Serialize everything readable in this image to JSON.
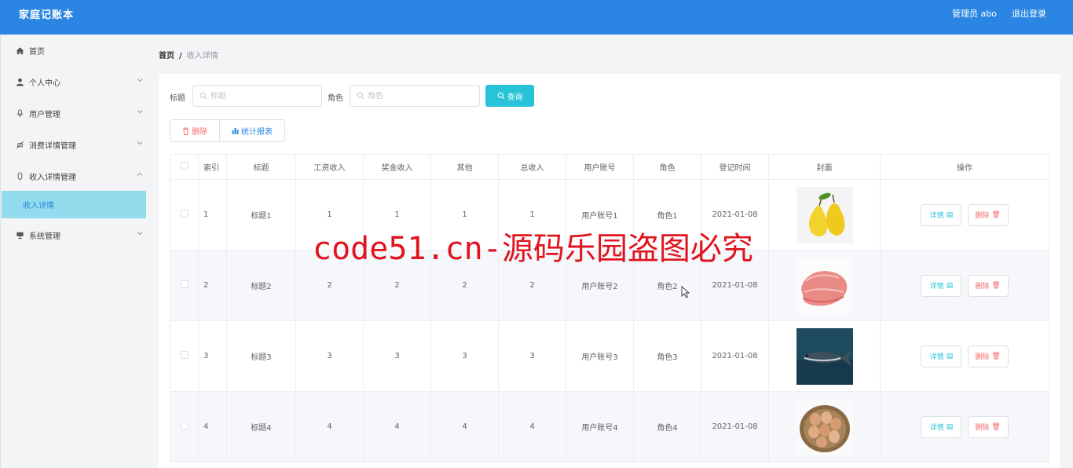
{
  "app": {
    "title": "家庭记账本",
    "user": "管理员 abo",
    "logout": "退出登录"
  },
  "sidebar": {
    "items": [
      {
        "label": "首页",
        "icon": "home-icon"
      },
      {
        "label": "个人中心",
        "icon": "user-icon"
      },
      {
        "label": "用户管理",
        "icon": "mic-icon"
      },
      {
        "label": "消费详情管理",
        "icon": "bell-off-icon"
      },
      {
        "label": "收入详情管理",
        "icon": "mic-icon"
      },
      {
        "label": "系统管理",
        "icon": "monitor-icon"
      }
    ],
    "active_sub": "收入详情"
  },
  "breadcrumb": {
    "home": "首页",
    "sep": "/",
    "current": "收入详情"
  },
  "search": {
    "title_label": "标题",
    "title_placeholder": "标题",
    "role_label": "角色",
    "role_placeholder": "角色",
    "query_button": "查询"
  },
  "actions": {
    "delete": "删除",
    "stats": "统计报表"
  },
  "table": {
    "headers": [
      "索引",
      "标题",
      "工资收入",
      "奖金收入",
      "其他",
      "总收入",
      "用户账号",
      "角色",
      "登记时间",
      "封面",
      "操作"
    ],
    "rows": [
      {
        "idx": "1",
        "title": "标题1",
        "salary": "1",
        "bonus": "1",
        "other": "1",
        "total": "1",
        "account": "用户账号1",
        "role": "角色1",
        "date": "2021-01-08",
        "cover": "pears"
      },
      {
        "idx": "2",
        "title": "标题2",
        "salary": "2",
        "bonus": "2",
        "other": "2",
        "total": "2",
        "account": "用户账号2",
        "role": "角色2",
        "date": "2021-01-08",
        "cover": "meat"
      },
      {
        "idx": "3",
        "title": "标题3",
        "salary": "3",
        "bonus": "3",
        "other": "3",
        "total": "3",
        "account": "用户账号3",
        "role": "角色3",
        "date": "2021-01-08",
        "cover": "fish"
      },
      {
        "idx": "4",
        "title": "标题4",
        "salary": "4",
        "bonus": "4",
        "other": "4",
        "total": "4",
        "account": "用户账号4",
        "role": "角色4",
        "date": "2021-01-08",
        "cover": "eggs"
      }
    ],
    "detail_label": "详情",
    "delete_label": "删除"
  },
  "watermark": "code51.cn-源码乐园盗图必究",
  "colors": {
    "header": "#2b86e3",
    "accent": "#27c4d8",
    "danger": "#f56c6c",
    "active_bg": "#93dced"
  }
}
